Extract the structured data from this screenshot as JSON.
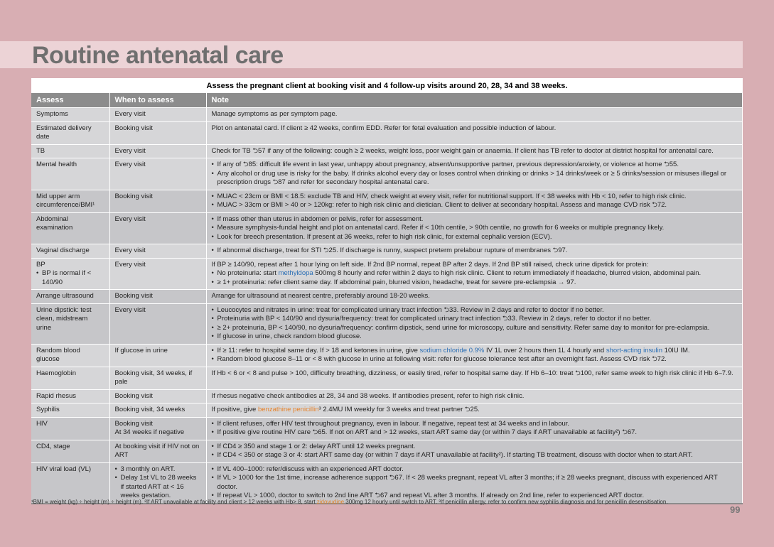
{
  "title": "Routine antenatal care",
  "banner": "Assess the pregnant client at booking visit and 4 follow-up visits around 20, 28, 34 and 38 weeks.",
  "headers": [
    "Assess",
    "When to assess",
    "Note"
  ],
  "rows": [
    {
      "assess": "Symptoms",
      "when": "Every visit",
      "note": "Manage symptoms as per symptom page."
    },
    {
      "assess": "Estimated delivery date",
      "when": "Booking visit",
      "note": "Plot on antenatal card. If client ≥ 42 weeks, confirm EDD. Refer for fetal evaluation and possible induction of labour."
    },
    {
      "assess": "TB",
      "when": "Every visit",
      "note": "Check for TB ⮌57 if any of the following: cough ≥ 2 weeks, weight loss, poor weight gain or anaemia. If client has TB refer to doctor at district hospital for antenatal care."
    },
    {
      "assess": "Mental health",
      "when": "Every visit",
      "bullets": [
        "If any of ⮌85: difficult life event in last year, unhappy about pregnancy, absent/unsupportive partner, previous depression/anxiety, or violence at home ⮌55.",
        "Any alcohol or drug use is risky for the baby. If drinks alcohol every day or loses control when drinking or drinks > 14 drinks/week or ≥ 5 drinks/session or misuses illegal or prescription drugs ⮌87 and refer for secondary hospital antenatal care."
      ]
    },
    {
      "assess": "Mid upper arm circumference/BMI¹",
      "when": "Booking visit",
      "bullets": [
        "MUAC < 23cm or BMI < 18.5: exclude TB and HIV, check weight at every visit, refer for nutritional support. If < 38 weeks with Hb < 10, refer to high risk clinic.",
        "MUAC > 33cm or BMI > 40 or > 120kg: refer to high risk clinic and dietician. Client to deliver at secondary hospital. Assess and manage CVD risk ⮌72."
      ]
    },
    {
      "assess": "Abdominal examination",
      "when": "Every visit",
      "bullets": [
        "If mass other than uterus in abdomen or pelvis, refer for assessment.",
        "Measure symphysis-fundal height and plot on antenatal card. Refer if < 10th centile, > 90th centile, no growth for 6 weeks or multiple pregnancy likely.",
        "Look for breech presentation. If present at 36 weeks, refer to high risk clinic, for external cephalic version (ECV)."
      ]
    },
    {
      "assess": "Vaginal discharge",
      "when": "Every visit",
      "bullets": [
        "If abnormal discharge, treat for STI ⮌25. If discharge is runny, suspect preterm prelabour rupture of membranes ⮌97."
      ]
    },
    {
      "assess": "BP",
      "assess_sub": "BP is normal if < 140/90",
      "when": "Every visit",
      "note": "If BP ≥ 140/90, repeat after 1 hour lying on left side. If 2nd BP normal, repeat BP after 2 days. If 2nd BP still raised, check urine dipstick for protein:",
      "bp_b1_pre": "No proteinuria: start ",
      "bp_b1_drug": "methyldopa",
      "bp_b1_post": " 500mg 8 hourly and refer within 2 days to high risk clinic. Client to return immediately if headache, blurred vision, abdominal pain.",
      "bp_b2": "≥ 1+ proteinuria: refer client same day. If abdominal pain, blurred vision, headache, treat for severe pre-eclampsia → 97."
    },
    {
      "assess": "Arrange ultrasound",
      "when": "Booking visit",
      "note": "Arrange for ultrasound at nearest centre, preferably around 18-20 weeks."
    },
    {
      "assess": "Urine dipstick: test clean, midstream urine",
      "when": "Every visit",
      "bullets": [
        "Leucocytes and nitrates in urine: treat for complicated urinary tract infection ⮌33. Review in 2 days and refer to doctor if no better.",
        "Proteinuria with BP < 140/90 and dysuria/frequency: treat for complicated urinary tract infection ⮌33. Review in 2 days, refer to doctor if no better.",
        "≥ 2+ proteinuria, BP < 140/90, no dysuria/frequency: confirm dipstick, send urine for microscopy, culture and sensitivity. Refer same day to monitor for pre-eclampsia.",
        "If glucose in urine, check random blood glucose."
      ]
    },
    {
      "assess": "Random blood glucose",
      "when": "If glucose in urine",
      "rbg_b1_pre": "If ≥ 11: refer to hospital same day. If > 18 and ketones in urine, give ",
      "rbg_b1_drug1": "sodium chloride 0.9%",
      "rbg_b1_mid": " IV 1L over 2 hours then 1L 4 hourly and ",
      "rbg_b1_drug2": "short-acting insulin",
      "rbg_b1_post": " 10IU IM.",
      "rbg_b2": "Random blood glucose 8–11 or < 8 with glucose in urine at following visit: refer for glucose tolerance test after an overnight fast. Assess CVD risk ⮌72."
    },
    {
      "assess": "Haemoglobin",
      "when": "Booking visit, 34 weeks, if pale",
      "note": "If Hb < 6 or < 8 and pulse > 100, difficulty breathing, dizziness, or easily tired, refer to hospital same day. If Hb 6–10: treat ⮌100, refer same week to high risk clinic if Hb 6–7.9."
    },
    {
      "assess": "Rapid rhesus",
      "when": "Booking visit",
      "note": "If rhesus negative check antibodies at 28, 34 and 38 weeks. If antibodies present, refer to high risk clinic."
    },
    {
      "assess": "Syphilis",
      "when": "Booking visit, 34 weeks",
      "syph_pre": "If positive, give ",
      "syph_drug": "benzathine penicillin",
      "syph_post": "³ 2.4MU IM weekly for 3 weeks and treat partner ⮌25."
    },
    {
      "assess": "HIV",
      "when": "Booking visit",
      "when2": "At 34 weeks if negative",
      "bullets": [
        "If client refuses, offer HIV test throughout pregnancy, even in labour. If negative, repeat test at 34 weeks and in labour.",
        "If positive give routine HIV care ⮌65. If not on ART and > 12 weeks, start ART same day (or within 7 days if ART unavailable at facility²) ⮌67."
      ]
    },
    {
      "assess": "CD4, stage",
      "when": "At booking visit if HIV not on ART",
      "bullets": [
        "If CD4 ≥ 350 and stage 1 or 2: delay ART until 12 weeks pregnant.",
        "If CD4 < 350 or stage 3 or 4: start ART same day (or within 7 days if ART unavailable at facility²). If starting TB treatment, discuss with doctor when to start ART."
      ]
    },
    {
      "assess": "HIV viral load (VL)",
      "when_bullets": [
        "3 monthly on ART.",
        "Delay 1st VL to 28 weeks if started ART at < 16 weeks gestation."
      ],
      "bullets": [
        "If VL 400–1000: refer/discuss with an experienced ART doctor.",
        "If VL > 1000 for the 1st time, increase adherence support ⮌67. If < 28 weeks pregnant, repeat VL after 3 months; if ≥ 28 weeks pregnant, discuss with experienced ART doctor.",
        "If repeat VL > 1000, doctor to switch to 2nd line ART ⮌67 and repeat VL after 3 months. If already on 2nd line, refer to experienced ART doctor."
      ]
    }
  ],
  "footnote_pre": "¹BMI = weight (kg) ÷ height (m) ÷ height (m).  ²If ART unavailable at facility and client > 12 weeks with Hb> 8, start ",
  "footnote_drug": "zidovudine",
  "footnote_post": " 300mg 12 hourly until switch to ART.  ³If penicillin allergy, refer to confirm new syphilis diagnosis and for penicillin desensitisation.",
  "page_number": "99",
  "colors": {
    "background": "#d8aeb3",
    "title_band": "#ecd3d6",
    "header": "#8c8c8c",
    "drug_blue": "#2c6fb5",
    "drug_orange": "#e6822a"
  }
}
